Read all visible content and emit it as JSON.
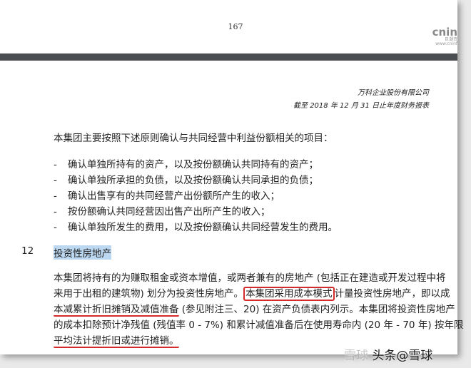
{
  "page_number": "167",
  "logo": {
    "name": "cnin",
    "sub1": "巨潮资",
    "sub2": "www.cninf"
  },
  "company": "万科企业股份有限公司",
  "period": "截至 2018 年 12 月 31 日止年度财务报表",
  "intro": "本集团主要按照下述原则确认与共同经营中利益份额相关的项目：",
  "bullets": [
    "确认单独所持有的资产，以及按份额确认共同持有的资产；",
    "确认单独所承担的负债，以及按份额确认共同承担的负债；",
    "确认出售享有的共同经营产出份额所产生的收入；",
    "按份额确认共同经营因出售产出所产生的收入；",
    "确认单独所发生的费用，以及按份额确认共同经营发生的费用。"
  ],
  "bullet_mark": "-",
  "section": {
    "number": "12",
    "title": "投资性房地产"
  },
  "para": {
    "l1": "本集团将持有的为赚取租金或资本增值，或两者兼有的房地产 (包括正在建造或开发过程中将",
    "l2a": "来用于出租的建筑物) 划分为投资性房地产。",
    "l2b": "本集团采用成本模式",
    "l2c": "计量投资性房地产，即以成",
    "l3a": "本减累计折旧摊销及减值准备",
    "l3b": " (参见附注三、20) 在资产负债表内列示。本集团将投资性房地产",
    "l4": "的成本扣除预计净残值 (残值率 0 - 7%) 和累计减值准备后在使用寿命内 (20 年 - 70 年) 按年限",
    "l5": "平均法计提折旧或进行摊销。"
  },
  "watermark": {
    "faded": "雪球",
    "text": "头条@雪球"
  }
}
